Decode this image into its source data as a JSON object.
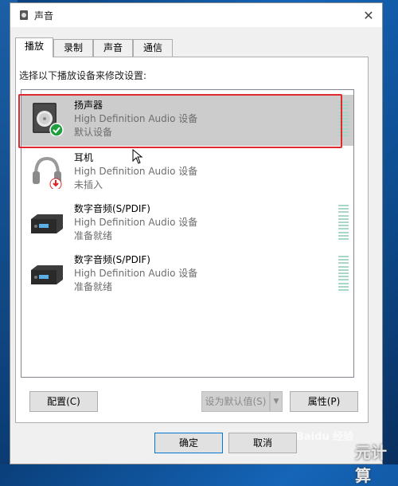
{
  "window": {
    "title": "声音"
  },
  "tabs": [
    {
      "label": "播放",
      "active": true
    },
    {
      "label": "录制",
      "active": false
    },
    {
      "label": "声音",
      "active": false
    },
    {
      "label": "通信",
      "active": false
    }
  ],
  "instruction": "选择以下播放设备来修改设置:",
  "devices": [
    {
      "name": "扬声器",
      "driver": "High Definition Audio 设备",
      "status": "默认设备",
      "icon": "speaker-icon",
      "badge": "default-check-icon",
      "selected": true
    },
    {
      "name": "耳机",
      "driver": "High Definition Audio 设备",
      "status": "未插入",
      "icon": "headphones-icon",
      "badge": "unplugged-arrow-icon",
      "selected": false
    },
    {
      "name": "数字音频(S/PDIF)",
      "driver": "High Definition Audio 设备",
      "status": "准备就绪",
      "icon": "spdif-device-icon",
      "selected": false
    },
    {
      "name": "数字音频(S/PDIF)",
      "driver": "High Definition Audio 设备",
      "status": "准备就绪",
      "icon": "spdif-device-icon",
      "selected": false
    }
  ],
  "buttons": {
    "configure": "配置(C)",
    "set_default": "设为默认值(S)",
    "properties": "属性(P)",
    "ok": "确定",
    "cancel": "取消"
  },
  "watermark": {
    "site": "Baidu 经验",
    "overlay": "元计算"
  },
  "colors": {
    "highlight_border": "#e0292f",
    "selected_row": "#cccccc",
    "meter": "#a8d7c6"
  }
}
